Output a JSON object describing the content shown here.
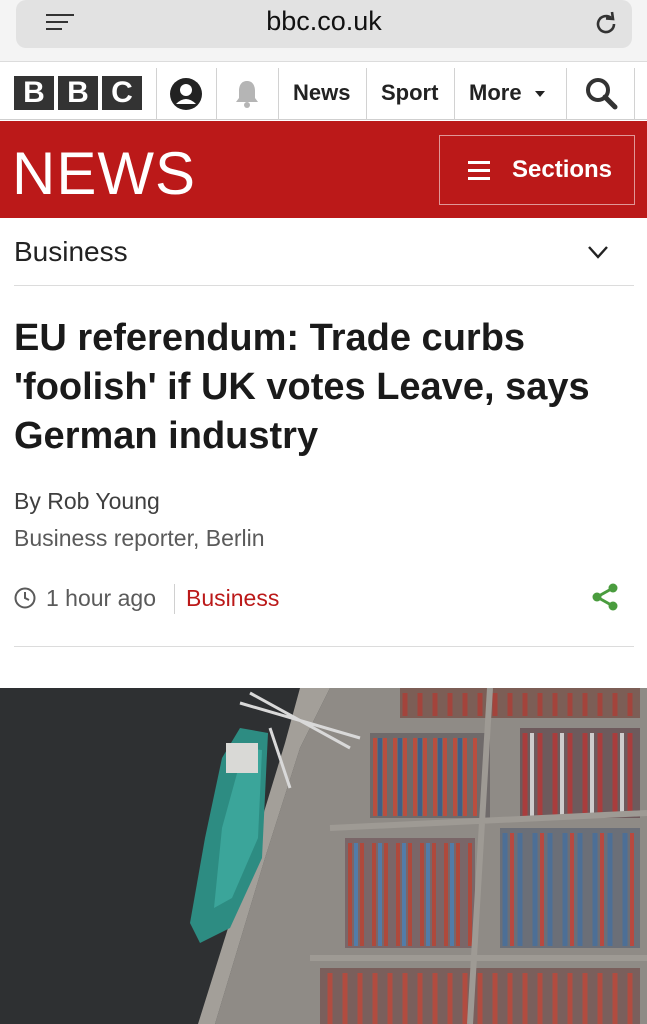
{
  "browser": {
    "url": "bbc.co.uk"
  },
  "nav": {
    "logo_letters": [
      "B",
      "B",
      "C"
    ],
    "links": [
      "News",
      "Sport",
      "More"
    ]
  },
  "banner": {
    "title": "NEWS",
    "sections_label": "Sections",
    "color": "#bb1919"
  },
  "section_strip": {
    "name": "Business"
  },
  "article": {
    "headline": "EU referendum: Trade curbs 'foolish' if UK votes Leave, says German industry",
    "author": "By Rob Young",
    "role": "Business reporter, Berlin",
    "time_ago": "1 hour ago",
    "section": "Business"
  },
  "image": {
    "subject": "aerial view of container port with ship and stacked shipping containers"
  },
  "colors": {
    "share": "#4a9c3e",
    "brand_red": "#bb1919"
  }
}
